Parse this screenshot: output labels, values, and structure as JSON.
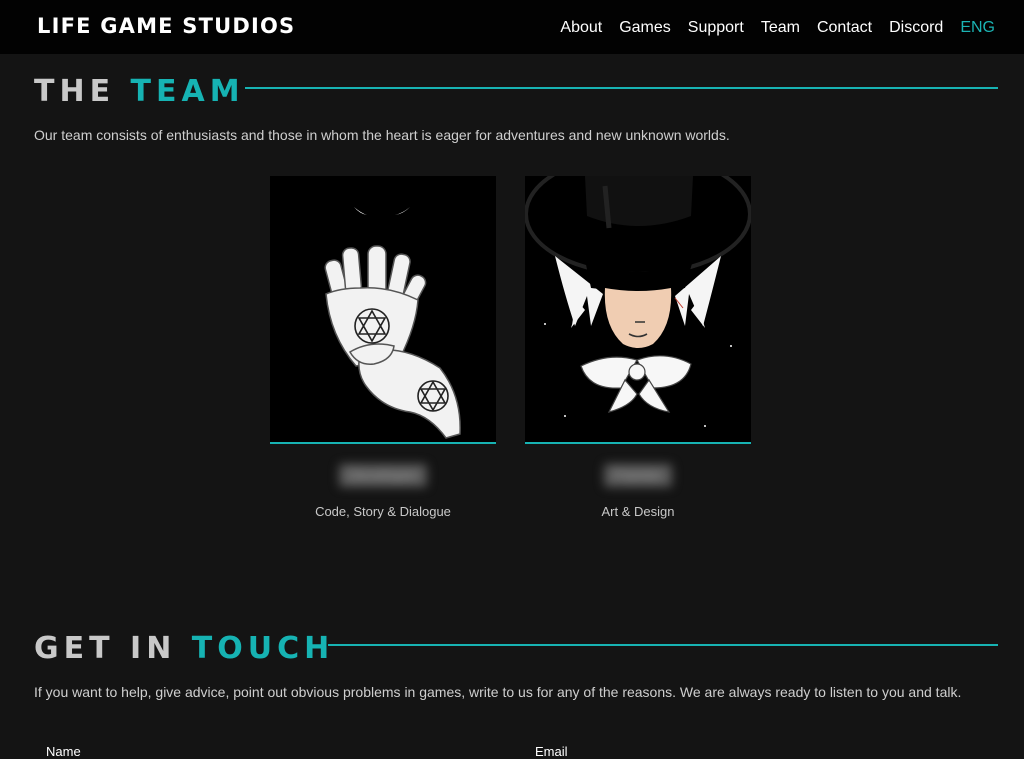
{
  "header": {
    "logo": "LIFE GAME STUDIOS",
    "nav": [
      {
        "label": "About"
      },
      {
        "label": "Games"
      },
      {
        "label": "Support"
      },
      {
        "label": "Team"
      },
      {
        "label": "Contact"
      },
      {
        "label": "Discord"
      },
      {
        "label": "ENG"
      }
    ]
  },
  "team": {
    "heading_part1": "THE",
    "heading_part2": "TEAM",
    "description": "Our team consists of enthusiasts and those in whom the heart is eager for adventures and new unknown worlds.",
    "members": [
      {
        "name": "Developer",
        "role": "Code, Story & Dialogue",
        "image_icon": "alchemy-hands-portrait"
      },
      {
        "name": "Painter",
        "role": "Art & Design",
        "image_icon": "top-hat-character-portrait"
      }
    ]
  },
  "contact": {
    "heading_part1": "GET IN",
    "heading_part2": "TOUCH",
    "description": "If you want to help, give advice, point out obvious problems in games, write to us for any of the reasons. We are always ready to listen to you and talk.",
    "name_label": "Name",
    "email_label": "Email"
  },
  "colors": {
    "accent": "#17b3b3",
    "background": "#141414",
    "navbar": "#020202"
  }
}
